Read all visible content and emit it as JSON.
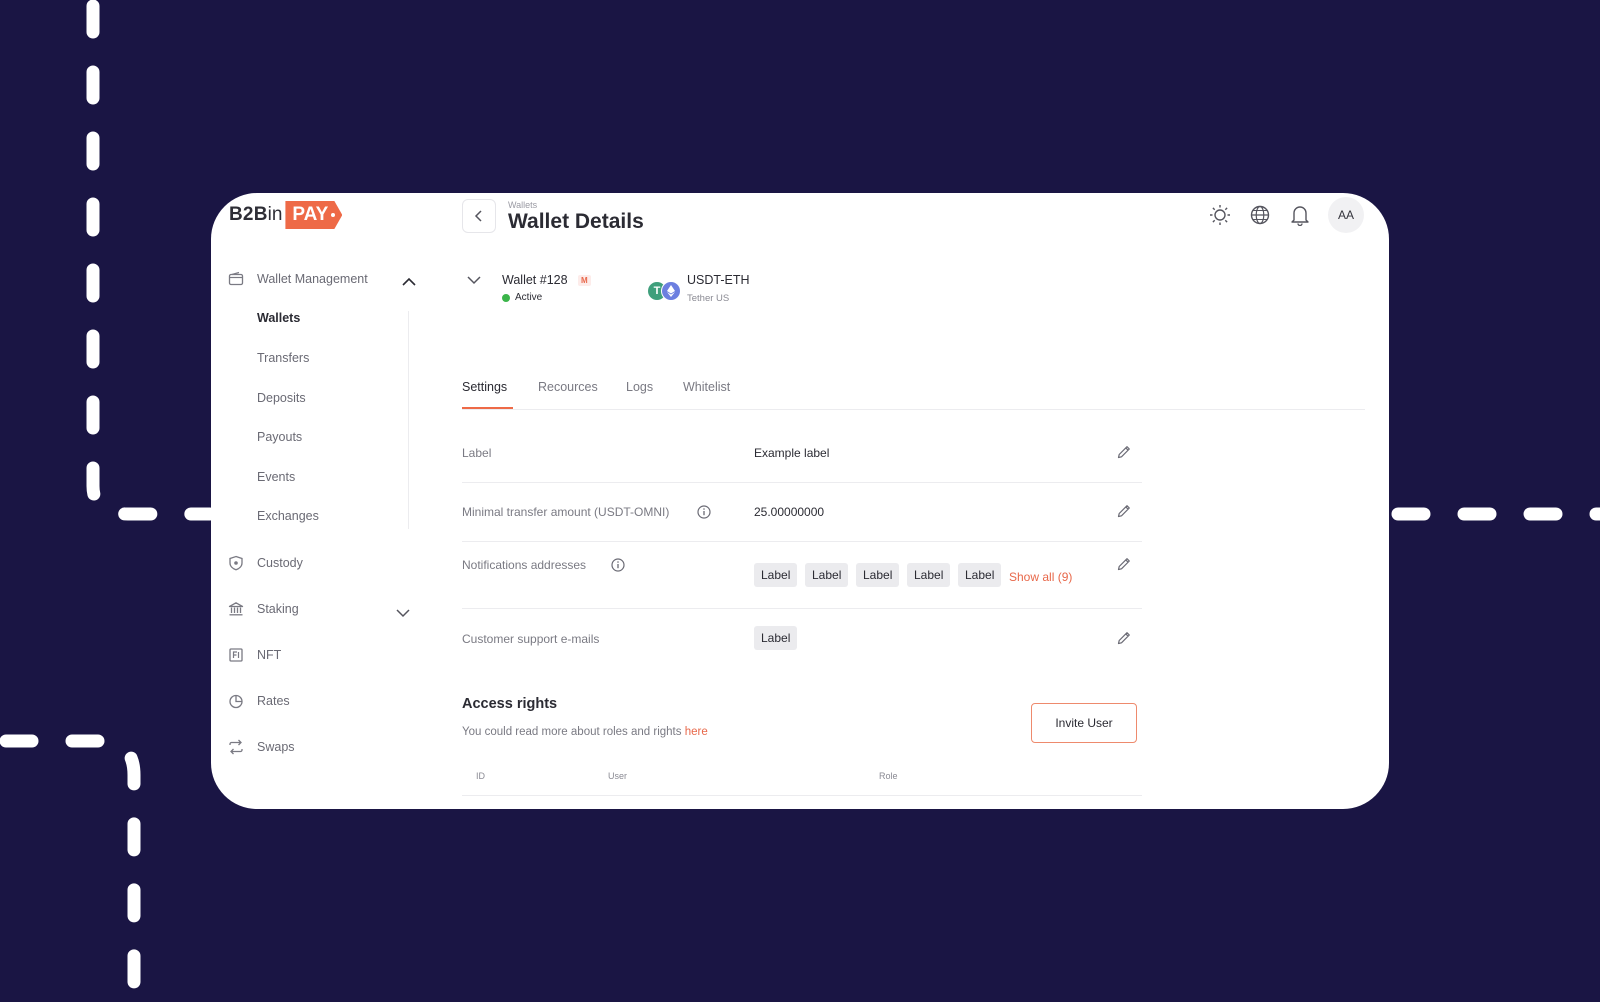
{
  "logo": {
    "part1": "B2B",
    "part2": "in",
    "part3": "PAY"
  },
  "header": {
    "breadcrumb": "Wallets",
    "title": "Wallet Details",
    "avatar_initials": "AA",
    "icons": [
      "sun-icon",
      "globe-icon",
      "bell-icon"
    ]
  },
  "sidebar": {
    "wallet_management": "Wallet Management",
    "sub_items": [
      "Wallets",
      "Transfers",
      "Deposits",
      "Payouts",
      "Events",
      "Exchanges"
    ],
    "active_sub_item": "Wallets",
    "custody": "Custody",
    "staking": "Staking",
    "nft": "NFT",
    "rates": "Rates",
    "swaps": "Swaps"
  },
  "wallet": {
    "name": "Wallet #128",
    "badge": "M",
    "status": "Active",
    "pair": "USDT-ETH",
    "pair_sub": "Tether US",
    "coin_glyph": "T"
  },
  "tabs": [
    "Settings",
    "Recources",
    "Logs",
    "Whitelist"
  ],
  "active_tab": "Settings",
  "settings": {
    "label_key": "Label",
    "label_value": "Example label",
    "min_transfer_key": "Minimal transfer amount (USDT-OMNI)",
    "min_transfer_value": "25.00000000",
    "notifications_key": "Notifications addresses",
    "notification_chips": [
      "Label",
      "Label",
      "Label",
      "Label",
      "Label"
    ],
    "show_all": "Show all (9)",
    "support_key": "Customer support e-mails",
    "support_chips": [
      "Label"
    ]
  },
  "access": {
    "title": "Access rights",
    "desc": "You could read more about roles and rights",
    "link": "here",
    "invite_button": "Invite User",
    "columns": [
      "ID",
      "User",
      "Role"
    ]
  },
  "colors": {
    "background": "#1a1544",
    "accent": "#ee6a47",
    "status_active": "#3bb54a"
  }
}
